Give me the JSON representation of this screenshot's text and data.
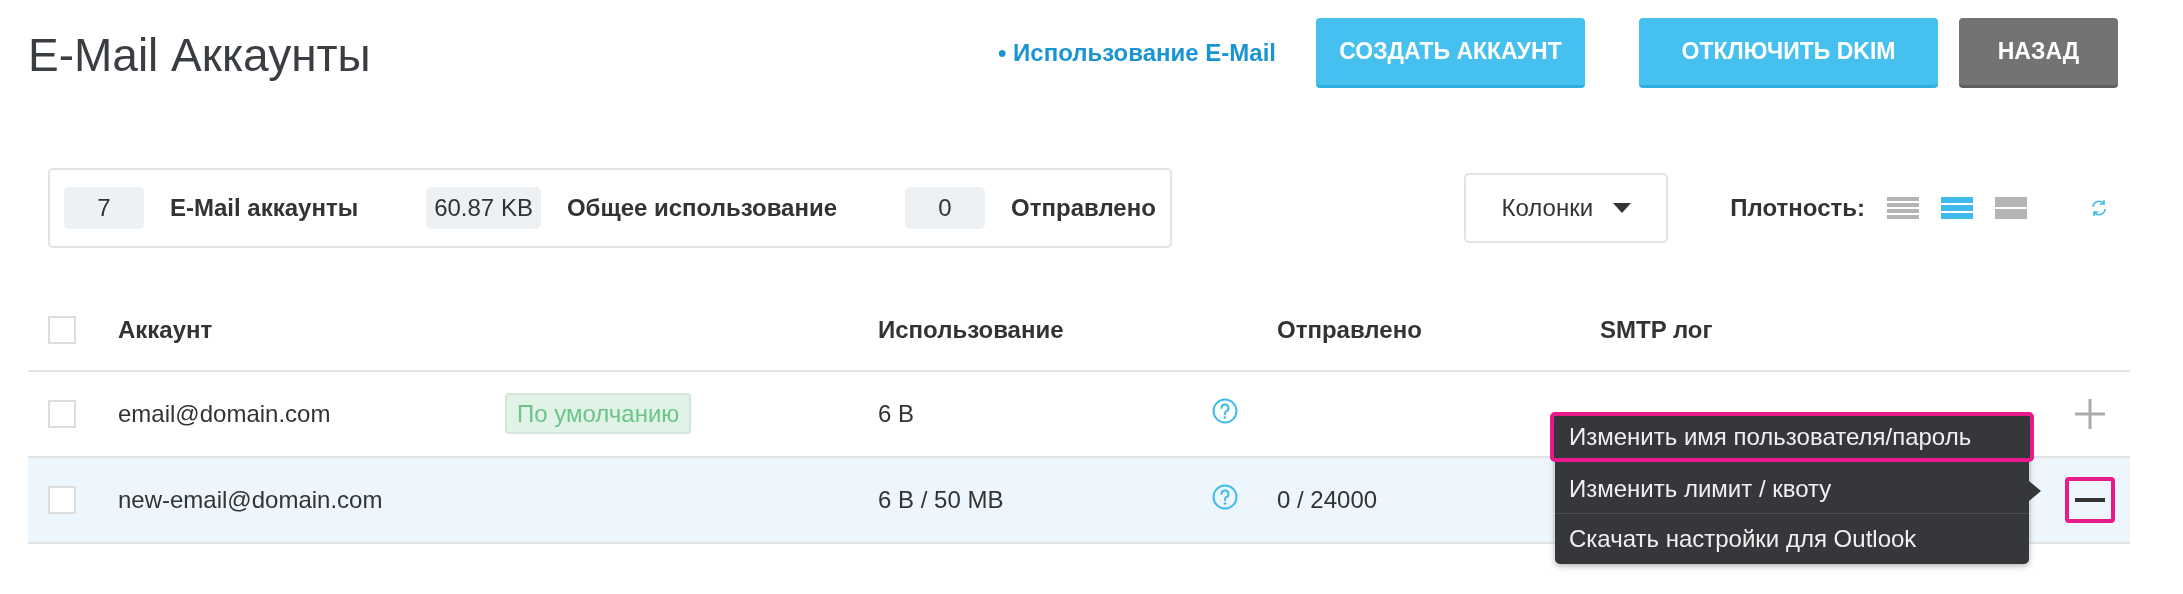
{
  "page": {
    "title": "E-Mail Аккаунты"
  },
  "usage_link": "• Использование E-Mail",
  "buttons": [
    {
      "label": "СОЗДАТЬ АККАУНТ",
      "kind": "primary"
    },
    {
      "label": "ОТКЛЮЧИТЬ DKIM",
      "kind": "primary"
    },
    {
      "label": "НАЗАД",
      "kind": "secondary"
    }
  ],
  "stats": [
    {
      "value": "7",
      "label": "E-Mail аккаунты"
    },
    {
      "value": "60.87 KB",
      "label": "Общее использование"
    },
    {
      "value": "0",
      "label": "Отправлено"
    }
  ],
  "columns_button": "Колонки",
  "density": {
    "label": "Плотность:",
    "options": [
      {
        "kind": "compact",
        "selected": false
      },
      {
        "kind": "medium",
        "selected": true
      },
      {
        "kind": "large",
        "selected": false
      }
    ]
  },
  "table": {
    "select_all": {
      "checked": false
    },
    "columns": [
      "Аккаунт",
      "Использование",
      "Отправлено",
      "SMTP лог"
    ],
    "rows": [
      {
        "checked": false,
        "selected": false,
        "expanded": false,
        "highlighted": false,
        "account": "email@domain.com",
        "badge": "По умолчанию",
        "usage": "6 B"
      },
      {
        "checked": false,
        "selected": true,
        "expanded": true,
        "highlighted": true,
        "account": "new-email@domain.com",
        "usage": "6 B / 50 MB",
        "sent": "0 / 24000"
      }
    ]
  },
  "context_menu": {
    "items": [
      {
        "label": "Изменить имя пользователя/пароль",
        "highlighted": true
      },
      {
        "label": "Изменить лимит / квоту",
        "highlighted": false
      },
      {
        "label": "Скачать настройки для Outlook",
        "highlighted": false
      }
    ]
  }
}
